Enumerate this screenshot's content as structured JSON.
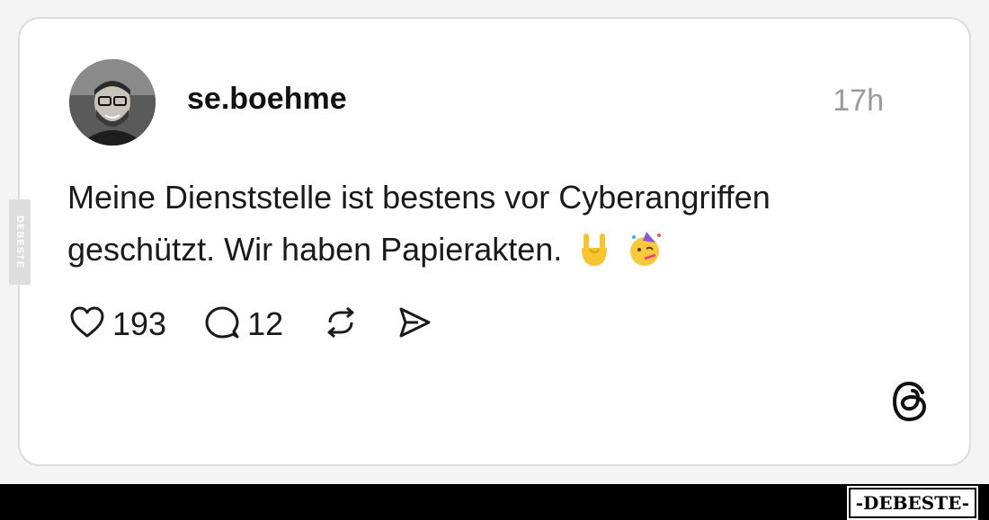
{
  "post": {
    "username": "se.boehme",
    "time": "17h",
    "text": "Meine Dienststelle ist bestens vor Cyberangriffen geschützt. Wir haben Papierakten.",
    "emojis": [
      "sign-of-the-horns",
      "partying-face"
    ]
  },
  "actions": {
    "likes": "193",
    "replies": "12"
  },
  "watermark": {
    "side": "DEBESTE",
    "footer": "-DEBESTE-"
  },
  "colors": {
    "card_background": "#ffffff",
    "card_border": "#dcdcdc",
    "time": "#9a9a9a",
    "footer_bar": "#000000"
  },
  "icons": [
    "heart-icon",
    "comment-icon",
    "repost-icon",
    "share-icon",
    "threads-logo-icon"
  ]
}
